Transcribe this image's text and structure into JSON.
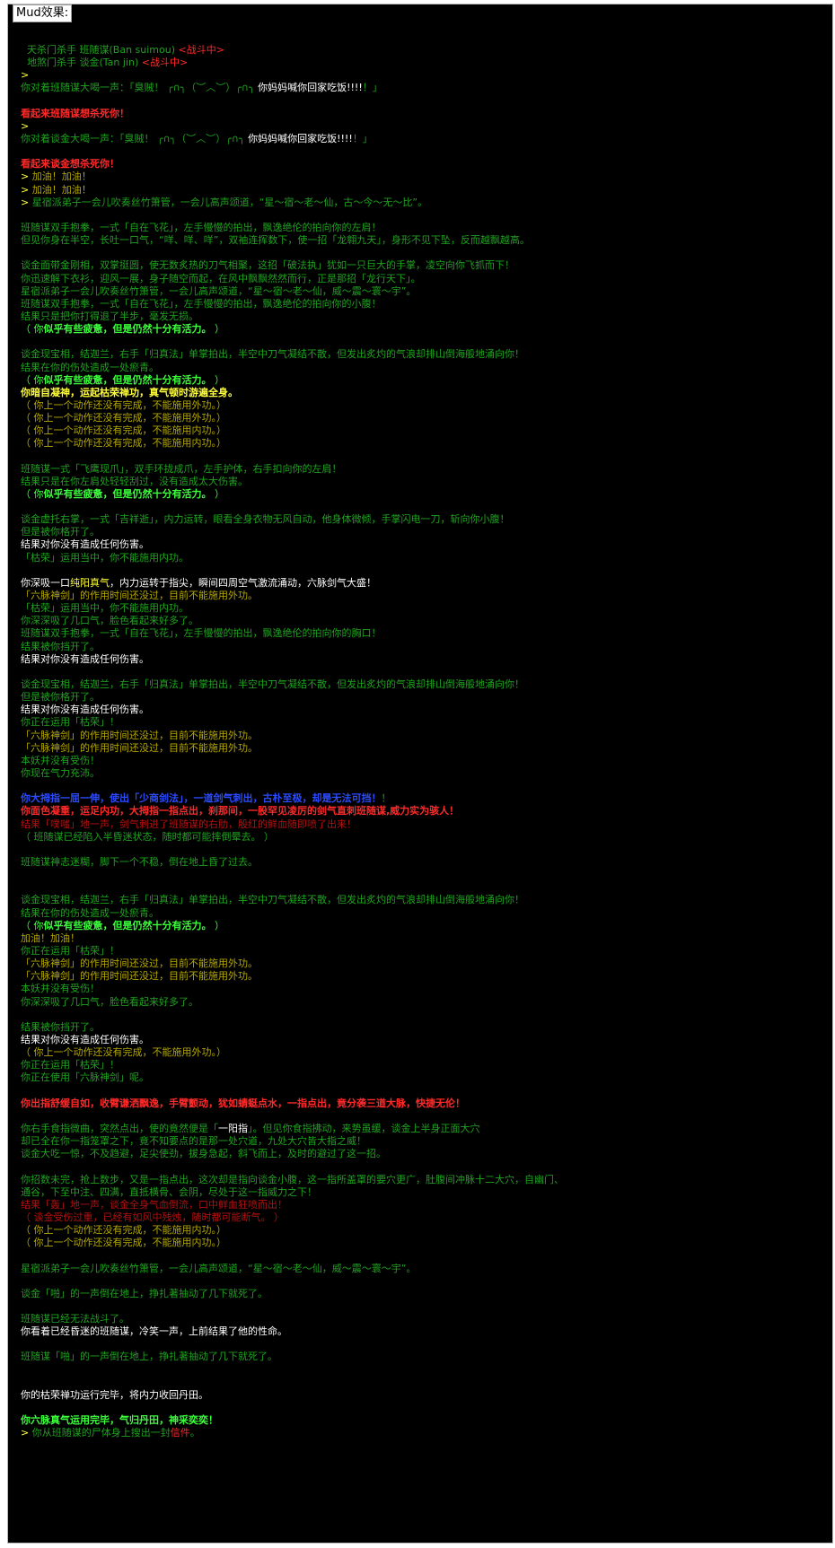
{
  "window": {
    "caption": "Mud效果:"
  },
  "lines": [
    {
      "segs": [
        {
          "t": "  天杀门杀手 班随谋(Ban suimou) ",
          "c": "c-green"
        },
        {
          "t": "<战斗中>",
          "c": "c-red"
        }
      ]
    },
    {
      "segs": [
        {
          "t": "  地煞门杀手 谈金(Tan jin) ",
          "c": "c-green"
        },
        {
          "t": "<战斗中>",
          "c": "c-red"
        }
      ]
    },
    {
      "segs": [
        {
          "t": ">",
          "c": "c-yellow"
        }
      ]
    },
    {
      "segs": [
        {
          "t": "你对着班随谋大喝一声：「臭贼！ ╭∩╮（︶︿︶）╭∩╮ ",
          "c": "c-green"
        },
        {
          "t": "你妈妈喊你回家吃饭!!!!",
          "c": "c-white"
        },
        {
          "t": "！」",
          "c": "c-green"
        }
      ]
    },
    {
      "segs": []
    },
    {
      "segs": [
        {
          "t": "看起来班随谋想杀死你！",
          "c": "c-red b"
        }
      ]
    },
    {
      "segs": [
        {
          "t": ">",
          "c": "c-yellow"
        }
      ]
    },
    {
      "segs": [
        {
          "t": "你对着谈金大喝一声：「臭贼！ ╭∩╮（︶︿︶）╭∩╮ ",
          "c": "c-green"
        },
        {
          "t": "你妈妈喊你回家吃饭!!!!",
          "c": "c-white"
        },
        {
          "t": "！」",
          "c": "c-green"
        }
      ]
    },
    {
      "segs": []
    },
    {
      "segs": [
        {
          "t": "看起来谈金想杀死你！",
          "c": "c-red b"
        }
      ]
    },
    {
      "segs": [
        {
          "t": "> ",
          "c": "c-yellow"
        },
        {
          "t": "加油！加油！",
          "c": "c-olive"
        }
      ]
    },
    {
      "segs": [
        {
          "t": "> ",
          "c": "c-yellow"
        },
        {
          "t": "加油！加油！",
          "c": "c-olive"
        }
      ]
    },
    {
      "segs": [
        {
          "t": "> ",
          "c": "c-yellow"
        },
        {
          "t": "星宿派弟子一会儿吹奏丝竹箫管，一会儿高声颂道，“星～宿～老～仙，古～今～无～比”。",
          "c": "c-green"
        }
      ]
    },
    {
      "segs": []
    },
    {
      "segs": [
        {
          "t": "班随谋双手抱拳，一式「自在飞花」，左手慢慢的拍出，飘逸绝伦的拍向你的左肩！",
          "c": "c-green"
        }
      ]
    },
    {
      "segs": [
        {
          "t": "但见你身在半空，长吐一口气，“咩、咩、咩”，双袖连挥数下，使一招「龙翱九天」，身形不见下坠，反而越飘越高。",
          "c": "c-green"
        }
      ]
    },
    {
      "segs": []
    },
    {
      "segs": [
        {
          "t": "谈金面带金刚相，双掌挺圆，使无数炙热的刀气相聚，这招「破法执」犹如一只巨大的手掌，凌空向你飞抓而下！",
          "c": "c-green"
        }
      ]
    },
    {
      "segs": [
        {
          "t": "你迅速解下衣衫，迎风一展，身子随空而起，在风中飘飘然然而行，正是那招「龙行天下」。",
          "c": "c-green"
        }
      ]
    },
    {
      "segs": [
        {
          "t": "星宿派弟子一会儿吹奏丝竹箫管，一会儿高声颂道，“星～宿～老～仙，威～震～寰～宇”。",
          "c": "c-green"
        }
      ]
    },
    {
      "segs": [
        {
          "t": "班随谋双手抱拳，一式「自在飞花」，左手慢慢的拍出，飘逸绝伦的拍向你的小腹！",
          "c": "c-green"
        }
      ]
    },
    {
      "segs": [
        {
          "t": "结果只是把你打得退了半步，毫发无损。",
          "c": "c-green"
        }
      ]
    },
    {
      "segs": [
        {
          "t": "（ 你",
          "c": "c-lgreen"
        },
        {
          "t": "似乎有些疲惫，但是仍然十分有活力。",
          "c": "c-lgreen b"
        },
        {
          "t": " ）",
          "c": "c-lgreen"
        }
      ]
    },
    {
      "segs": []
    },
    {
      "segs": [
        {
          "t": "谈金现宝相，结迦兰，右手「归真法」单掌拍出，半空中刀气凝结不散，但发出炙灼的气浪却排山倒海般地涌向你！",
          "c": "c-green"
        }
      ]
    },
    {
      "segs": [
        {
          "t": "结果在你的伤处造成一处瘀青。",
          "c": "c-green"
        }
      ]
    },
    {
      "segs": [
        {
          "t": "（ 你",
          "c": "c-lgreen"
        },
        {
          "t": "似乎有些疲惫，但是仍然十分有活力。",
          "c": "c-lgreen b"
        },
        {
          "t": " ）",
          "c": "c-lgreen"
        }
      ]
    },
    {
      "segs": [
        {
          "t": "你暗自凝神，运起枯荣禅功，真气顿时游遍全身。",
          "c": "c-yellow b"
        }
      ]
    },
    {
      "segs": [
        {
          "t": "（ 你上一个动作还没有完成，不能施用外功。）",
          "c": "c-olive"
        }
      ]
    },
    {
      "segs": [
        {
          "t": "（ 你上一个动作还没有完成，不能施用外功。）",
          "c": "c-olive"
        }
      ]
    },
    {
      "segs": [
        {
          "t": "（ 你上一个动作还没有完成，不能施用内功。）",
          "c": "c-olive"
        }
      ]
    },
    {
      "segs": [
        {
          "t": "（ 你上一个动作还没有完成，不能施用内功。）",
          "c": "c-olive"
        }
      ]
    },
    {
      "segs": []
    },
    {
      "segs": [
        {
          "t": "班随谋一式「飞鹰现爪」，双手环拢成爪，左手护体，右手扣向你的左肩！",
          "c": "c-green"
        }
      ]
    },
    {
      "segs": [
        {
          "t": "结果只是在你左肩处轻轻刮过，没有造成太大伤害。",
          "c": "c-green"
        }
      ]
    },
    {
      "segs": [
        {
          "t": "（ 你",
          "c": "c-lgreen"
        },
        {
          "t": "似乎有些疲惫，但是仍然十分有活力。",
          "c": "c-lgreen b"
        },
        {
          "t": " ）",
          "c": "c-lgreen"
        }
      ]
    },
    {
      "segs": []
    },
    {
      "segs": [
        {
          "t": "谈金虚托右掌，一式「吉祥逝」，内力运转，眼看全身衣物无风自动，他身体微倾，手掌闪电一刀，斩向你小腹！",
          "c": "c-green"
        }
      ]
    },
    {
      "segs": [
        {
          "t": "但是被你格开了。",
          "c": "c-green"
        }
      ]
    },
    {
      "segs": [
        {
          "t": "结果对你没有造成任何伤害。",
          "c": "c-white"
        }
      ]
    },
    {
      "segs": [
        {
          "t": "「枯荣」运用当中，你不能施用内功。",
          "c": "c-green"
        }
      ]
    },
    {
      "segs": []
    },
    {
      "segs": [
        {
          "t": "你深吸一口",
          "c": "c-white"
        },
        {
          "t": "纯阳真气",
          "c": "c-yellow"
        },
        {
          "t": "，内力运转于指尖，瞬间四周空气激流涌动，六脉剑气大盛！",
          "c": "c-white"
        }
      ]
    },
    {
      "segs": [
        {
          "t": "「六脉神剑」的作用时间还没过，目前不能施用外功。",
          "c": "c-olive"
        }
      ]
    },
    {
      "segs": [
        {
          "t": "「枯荣」运用当中，你不能施用内功。",
          "c": "c-green"
        }
      ]
    },
    {
      "segs": [
        {
          "t": "你深深吸了几口气，脸色看起来好多了。",
          "c": "c-green"
        }
      ]
    },
    {
      "segs": [
        {
          "t": "班随谋双手抱拳，一式「自在飞花」，左手慢慢的拍出，飘逸绝伦的拍向你的胸口！",
          "c": "c-green"
        }
      ]
    },
    {
      "segs": [
        {
          "t": "结果被你挡开了。",
          "c": "c-green"
        }
      ]
    },
    {
      "segs": [
        {
          "t": "结果对你没有造成任何伤害。",
          "c": "c-white"
        }
      ]
    },
    {
      "segs": []
    },
    {
      "segs": [
        {
          "t": "谈金现宝相，结迦兰，右手「归真法」单掌拍出，半空中刀气凝结不散，但发出炙灼的气浪却排山倒海般地涌向你！",
          "c": "c-green"
        }
      ]
    },
    {
      "segs": [
        {
          "t": "但是被你格开了。",
          "c": "c-green"
        }
      ]
    },
    {
      "segs": [
        {
          "t": "结果对你没有造成任何伤害。",
          "c": "c-white"
        }
      ]
    },
    {
      "segs": [
        {
          "t": "你正在运用「枯荣」！",
          "c": "c-green"
        }
      ]
    },
    {
      "segs": [
        {
          "t": "「六脉神剑」的作用时间还没过，目前不能施用外功。",
          "c": "c-olive"
        }
      ]
    },
    {
      "segs": [
        {
          "t": "「六脉神剑」的作用时间还没过，目前不能施用外功。",
          "c": "c-olive"
        }
      ]
    },
    {
      "segs": [
        {
          "t": "本妖并没有受伤！",
          "c": "c-green"
        }
      ]
    },
    {
      "segs": [
        {
          "t": "你现在气力充沛。",
          "c": "c-green"
        }
      ]
    },
    {
      "segs": []
    },
    {
      "segs": [
        {
          "t": "你大拇指一屈一伸，使出「少商剑法」，一道剑气刺出，古朴至极，却是无法可挡！",
          "c": "c-blue b"
        },
        {
          "t": "！",
          "c": "c-green"
        }
      ]
    },
    {
      "segs": [
        {
          "t": "你面色凝重，运足内功，大拇指一指点出，刹那间，一股罕见凌厉的剑气直刺班随谋,威力实为骇人！",
          "c": "c-red b"
        }
      ]
    },
    {
      "segs": [
        {
          "t": "结果「噗嗤」地一声，剑气刺进了班随谋的右肋，殷红的鲜血随即喷了出来！",
          "c": "c-dred"
        }
      ]
    },
    {
      "segs": [
        {
          "t": "（ 班随谋已经陷入半昏迷状态，随时都可能摔倒晕去。 ）",
          "c": "c-green"
        }
      ]
    },
    {
      "segs": []
    },
    {
      "segs": [
        {
          "t": "班随谋神志迷糊，脚下一个不稳，倒在地上昏了过去。",
          "c": "c-green"
        }
      ]
    },
    {
      "segs": []
    },
    {
      "segs": []
    },
    {
      "segs": [
        {
          "t": "谈金现宝相，结迦兰，右手「归真法」单掌拍出，半空中刀气凝结不散，但发出炙灼的气浪却排山倒海般地涌向你！",
          "c": "c-green"
        }
      ]
    },
    {
      "segs": [
        {
          "t": "结果在你的伤处造成一处瘀青。",
          "c": "c-green"
        }
      ]
    },
    {
      "segs": [
        {
          "t": "（ 你",
          "c": "c-lgreen"
        },
        {
          "t": "似乎有些疲惫，但是仍然十分有活力。",
          "c": "c-lgreen b"
        },
        {
          "t": " ）",
          "c": "c-lgreen"
        }
      ]
    },
    {
      "segs": [
        {
          "t": "加油！加油！",
          "c": "c-olive"
        }
      ]
    },
    {
      "segs": [
        {
          "t": "你正在运用「枯荣」！",
          "c": "c-green"
        }
      ]
    },
    {
      "segs": [
        {
          "t": "「六脉神剑」的作用时间还没过，目前不能施用外功。",
          "c": "c-olive"
        }
      ]
    },
    {
      "segs": [
        {
          "t": "「六脉神剑」的作用时间还没过，目前不能施用外功。",
          "c": "c-olive"
        }
      ]
    },
    {
      "segs": [
        {
          "t": "本妖并没有受伤！",
          "c": "c-green"
        }
      ]
    },
    {
      "segs": [
        {
          "t": "你深深吸了几口气，脸色看起来好多了。",
          "c": "c-green"
        }
      ]
    },
    {
      "segs": []
    },
    {
      "segs": [
        {
          "t": "结果被你挡开了。",
          "c": "c-green"
        }
      ]
    },
    {
      "segs": [
        {
          "t": "结果对你没有造成任何伤害。",
          "c": "c-white"
        }
      ]
    },
    {
      "segs": [
        {
          "t": "（ 你上一个动作还没有完成，不能施用外功。）",
          "c": "c-olive"
        }
      ]
    },
    {
      "segs": [
        {
          "t": "你正在运用「枯荣」！",
          "c": "c-green"
        }
      ]
    },
    {
      "segs": [
        {
          "t": "你正在使用「六脉神剑」呢。",
          "c": "c-green"
        }
      ]
    },
    {
      "segs": []
    },
    {
      "segs": [
        {
          "t": "你出指舒缓自如，收臂谦洒飘逸，手臂颤动，犹如蜻蜓点水，一指点出，竟分袭三道大脉，快捷无伦！",
          "c": "c-red b"
        }
      ]
    },
    {
      "segs": []
    },
    {
      "segs": [
        {
          "t": "你右手食指微曲，突然点出，使的竟然便是「",
          "c": "c-green"
        },
        {
          "t": "一阳指",
          "c": "c-white"
        },
        {
          "t": "」。但见你食指拂动，来势虽缓，谈金上半身正面大穴",
          "c": "c-green"
        }
      ]
    },
    {
      "segs": [
        {
          "t": "却已全在你一指笼罩之下，竟不知要点的是那一处穴道，九处大穴皆大指之威！",
          "c": "c-green"
        }
      ]
    },
    {
      "segs": [
        {
          "t": "谈金大吃一惊，不及趋避，足尖使劲，拔身急起，斜飞而上，及时的避过了这一招。",
          "c": "c-green"
        }
      ]
    },
    {
      "segs": []
    },
    {
      "segs": [
        {
          "t": "你招数未完，抢上数步，又是一指点出，这次却是指向谈金小腹，这一指所盖罩的要穴更广，肚腹间冲脉十二大穴，自幽门、",
          "c": "c-green"
        }
      ]
    },
    {
      "segs": [
        {
          "t": "通谷，下至中注、四满，直抵横骨、会阴，尽处于这一指威力之下！",
          "c": "c-green"
        }
      ]
    },
    {
      "segs": [
        {
          "t": "结果「轰」地一声，谈金全身气血倒流，口中鲜血狂喷而出！",
          "c": "c-dred"
        }
      ]
    },
    {
      "segs": [
        {
          "t": "（ 谈金受伤过重，已经有如风中残烛，随时都可能断气。 ）",
          "c": "c-dred"
        }
      ]
    },
    {
      "segs": [
        {
          "t": "（ 你上一个动作还没有完成，不能施用内功。）",
          "c": "c-olive"
        }
      ]
    },
    {
      "segs": [
        {
          "t": "（ 你上一个动作还没有完成，不能施用内功。）",
          "c": "c-olive"
        }
      ]
    },
    {
      "segs": []
    },
    {
      "segs": [
        {
          "t": "星宿派弟子一会儿吹奏丝竹箫管，一会儿高声颂道，“星～宿～老～仙，威～震～寰～宇”。",
          "c": "c-green"
        }
      ]
    },
    {
      "segs": []
    },
    {
      "segs": [
        {
          "t": "谈金「啪」的一声倒在地上，挣扎著抽动了几下就死了。",
          "c": "c-green"
        }
      ]
    },
    {
      "segs": []
    },
    {
      "segs": [
        {
          "t": "班随谋已经无法战斗了。",
          "c": "c-green"
        }
      ]
    },
    {
      "segs": [
        {
          "t": "你看着已经昏迷的班随谋，冷笑一声，上前结果了他的性命。",
          "c": "c-white"
        }
      ]
    },
    {
      "segs": []
    },
    {
      "segs": [
        {
          "t": "班随谋「啪」的一声倒在地上，挣扎著抽动了几下就死了。",
          "c": "c-green"
        }
      ]
    },
    {
      "segs": []
    },
    {
      "segs": []
    },
    {
      "segs": [
        {
          "t": "你的枯荣禅功运行完毕，将内力收回丹田。",
          "c": "c-white"
        }
      ]
    },
    {
      "segs": []
    },
    {
      "segs": [
        {
          "t": "你六脉真气运用完毕，气归丹田，神采奕奕！",
          "c": "c-lgreen b"
        }
      ]
    },
    {
      "segs": [
        {
          "t": "> ",
          "c": "c-yellow"
        },
        {
          "t": "你从班随谋的尸体身上搜出一封",
          "c": "c-green"
        },
        {
          "t": "信件",
          "c": "c-red"
        },
        {
          "t": "。",
          "c": "c-green"
        }
      ]
    }
  ]
}
